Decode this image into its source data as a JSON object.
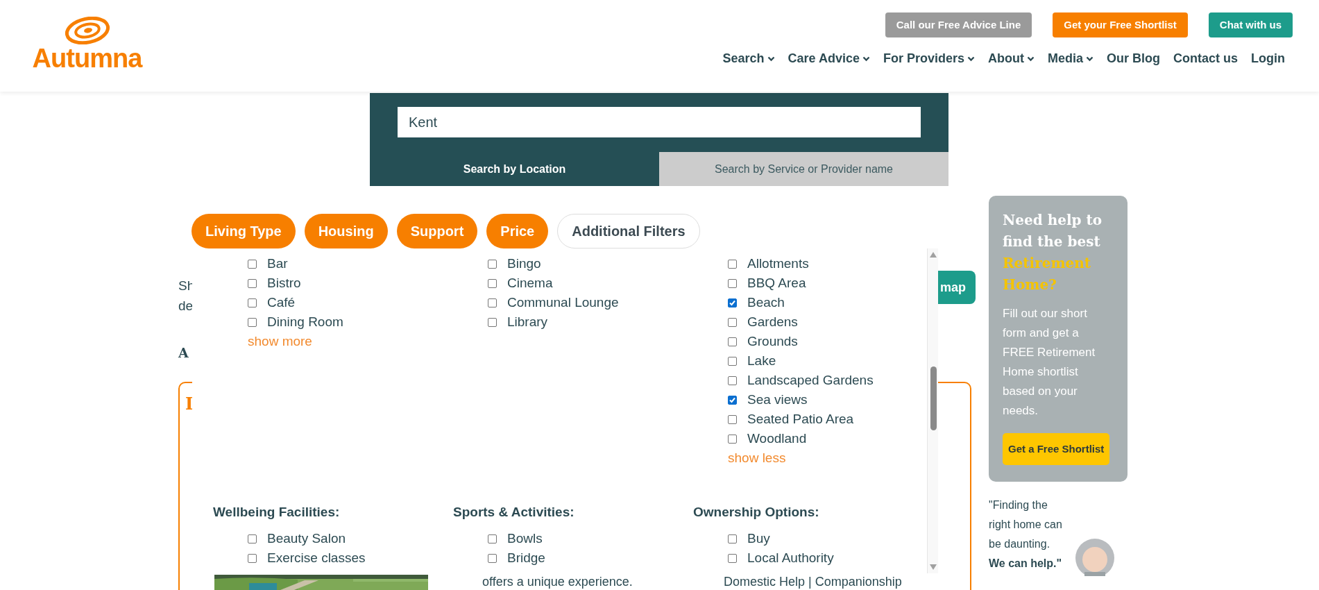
{
  "header": {
    "logo": "Autumna",
    "top_buttons": [
      {
        "label": "Call our Free Advice Line",
        "kind": "gray"
      },
      {
        "label": "Get your Free Shortlist",
        "kind": "orange"
      },
      {
        "label": "Chat with us",
        "kind": "teal"
      }
    ],
    "nav": [
      {
        "label": "Search",
        "dropdown": true
      },
      {
        "label": "Care Advice",
        "dropdown": true
      },
      {
        "label": "For Providers",
        "dropdown": true
      },
      {
        "label": "About",
        "dropdown": true
      },
      {
        "label": "Media",
        "dropdown": true
      },
      {
        "label": "Our Blog",
        "dropdown": false
      },
      {
        "label": "Contact us",
        "dropdown": false
      },
      {
        "label": "Login",
        "dropdown": false
      }
    ]
  },
  "search": {
    "value": "Kent",
    "tabs": [
      {
        "label": "Search by Location",
        "selected": true
      },
      {
        "label": "Search by Service or Provider name",
        "selected": false
      }
    ]
  },
  "filters": [
    {
      "label": "Living Type",
      "kind": "pill"
    },
    {
      "label": "Housing",
      "kind": "pill"
    },
    {
      "label": "Support",
      "kind": "pill"
    },
    {
      "label": "Price",
      "kind": "pill"
    },
    {
      "label": "Additional Filters",
      "kind": "outline"
    }
  ],
  "background": {
    "fragments": [
      "Sh",
      "de"
    ],
    "subheading": "A",
    "card_heading": "I",
    "map_button": "map",
    "card_texts": [
      "offers a unique experience.",
      "Domestic Help | Companionship"
    ]
  },
  "filter_panel": {
    "upper_columns": [
      {
        "options": [
          {
            "label": "Bar",
            "checked": false
          },
          {
            "label": "Bistro",
            "checked": false
          },
          {
            "label": "Café",
            "checked": false
          },
          {
            "label": "Dining Room",
            "checked": false
          }
        ],
        "link": "show more"
      },
      {
        "options": [
          {
            "label": "Bingo",
            "checked": false
          },
          {
            "label": "Cinema",
            "checked": false
          },
          {
            "label": "Communal Lounge",
            "checked": false
          },
          {
            "label": "Library",
            "checked": false
          }
        ]
      },
      {
        "options": [
          {
            "label": "Allotments",
            "checked": false
          },
          {
            "label": "BBQ Area",
            "checked": false
          },
          {
            "label": "Beach",
            "checked": true
          },
          {
            "label": "Gardens",
            "checked": false
          },
          {
            "label": "Grounds",
            "checked": false
          },
          {
            "label": "Lake",
            "checked": false
          },
          {
            "label": "Landscaped Gardens",
            "checked": false
          },
          {
            "label": "Sea views",
            "checked": true
          },
          {
            "label": "Seated Patio Area",
            "checked": false
          },
          {
            "label": "Woodland",
            "checked": false
          }
        ],
        "link": "show less"
      }
    ],
    "lower_columns": [
      {
        "heading": "Wellbeing Facilities:",
        "options": [
          {
            "label": "Beauty Salon",
            "checked": false
          },
          {
            "label": "Exercise classes",
            "checked": false
          }
        ]
      },
      {
        "heading": "Sports & Activities:",
        "options": [
          {
            "label": "Bowls",
            "checked": false
          },
          {
            "label": "Bridge",
            "checked": false
          }
        ]
      },
      {
        "heading": "Ownership Options:",
        "options": [
          {
            "label": "Buy",
            "checked": false
          },
          {
            "label": "Local Authority",
            "checked": false
          }
        ]
      }
    ]
  },
  "sidebar": {
    "title": "Need help to find the best",
    "title_highlight": "Retirement Home?",
    "body": "Fill out our short form and get a FREE Retirement Home shortlist based on your needs.",
    "button": "Get a Free Shortlist",
    "quote": "\"Finding the right home can be daunting. **We can help.\"**"
  }
}
